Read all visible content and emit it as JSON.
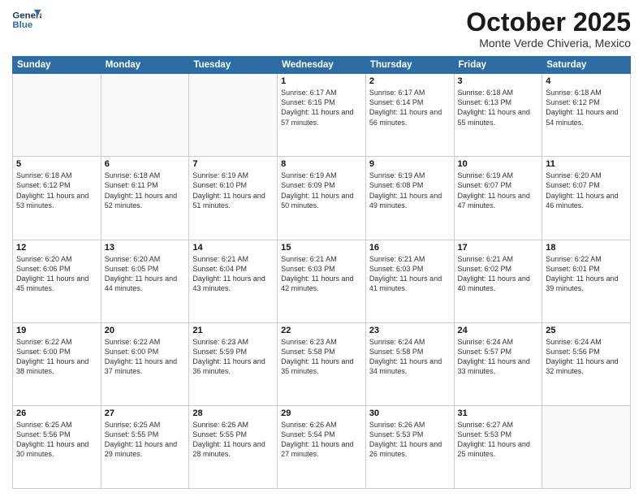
{
  "logo": {
    "line1": "General",
    "line2": "Blue"
  },
  "title": "October 2025",
  "location": "Monte Verde Chiveria, Mexico",
  "days_header": [
    "Sunday",
    "Monday",
    "Tuesday",
    "Wednesday",
    "Thursday",
    "Friday",
    "Saturday"
  ],
  "weeks": [
    [
      {
        "day": "",
        "info": ""
      },
      {
        "day": "",
        "info": ""
      },
      {
        "day": "",
        "info": ""
      },
      {
        "day": "1",
        "info": "Sunrise: 6:17 AM\nSunset: 6:15 PM\nDaylight: 11 hours and 57 minutes."
      },
      {
        "day": "2",
        "info": "Sunrise: 6:17 AM\nSunset: 6:14 PM\nDaylight: 11 hours and 56 minutes."
      },
      {
        "day": "3",
        "info": "Sunrise: 6:18 AM\nSunset: 6:13 PM\nDaylight: 11 hours and 55 minutes."
      },
      {
        "day": "4",
        "info": "Sunrise: 6:18 AM\nSunset: 6:12 PM\nDaylight: 11 hours and 54 minutes."
      }
    ],
    [
      {
        "day": "5",
        "info": "Sunrise: 6:18 AM\nSunset: 6:12 PM\nDaylight: 11 hours and 53 minutes."
      },
      {
        "day": "6",
        "info": "Sunrise: 6:18 AM\nSunset: 6:11 PM\nDaylight: 11 hours and 52 minutes."
      },
      {
        "day": "7",
        "info": "Sunrise: 6:19 AM\nSunset: 6:10 PM\nDaylight: 11 hours and 51 minutes."
      },
      {
        "day": "8",
        "info": "Sunrise: 6:19 AM\nSunset: 6:09 PM\nDaylight: 11 hours and 50 minutes."
      },
      {
        "day": "9",
        "info": "Sunrise: 6:19 AM\nSunset: 6:08 PM\nDaylight: 11 hours and 49 minutes."
      },
      {
        "day": "10",
        "info": "Sunrise: 6:19 AM\nSunset: 6:07 PM\nDaylight: 11 hours and 47 minutes."
      },
      {
        "day": "11",
        "info": "Sunrise: 6:20 AM\nSunset: 6:07 PM\nDaylight: 11 hours and 46 minutes."
      }
    ],
    [
      {
        "day": "12",
        "info": "Sunrise: 6:20 AM\nSunset: 6:06 PM\nDaylight: 11 hours and 45 minutes."
      },
      {
        "day": "13",
        "info": "Sunrise: 6:20 AM\nSunset: 6:05 PM\nDaylight: 11 hours and 44 minutes."
      },
      {
        "day": "14",
        "info": "Sunrise: 6:21 AM\nSunset: 6:04 PM\nDaylight: 11 hours and 43 minutes."
      },
      {
        "day": "15",
        "info": "Sunrise: 6:21 AM\nSunset: 6:03 PM\nDaylight: 11 hours and 42 minutes."
      },
      {
        "day": "16",
        "info": "Sunrise: 6:21 AM\nSunset: 6:03 PM\nDaylight: 11 hours and 41 minutes."
      },
      {
        "day": "17",
        "info": "Sunrise: 6:21 AM\nSunset: 6:02 PM\nDaylight: 11 hours and 40 minutes."
      },
      {
        "day": "18",
        "info": "Sunrise: 6:22 AM\nSunset: 6:01 PM\nDaylight: 11 hours and 39 minutes."
      }
    ],
    [
      {
        "day": "19",
        "info": "Sunrise: 6:22 AM\nSunset: 6:00 PM\nDaylight: 11 hours and 38 minutes."
      },
      {
        "day": "20",
        "info": "Sunrise: 6:22 AM\nSunset: 6:00 PM\nDaylight: 11 hours and 37 minutes."
      },
      {
        "day": "21",
        "info": "Sunrise: 6:23 AM\nSunset: 5:59 PM\nDaylight: 11 hours and 36 minutes."
      },
      {
        "day": "22",
        "info": "Sunrise: 6:23 AM\nSunset: 5:58 PM\nDaylight: 11 hours and 35 minutes."
      },
      {
        "day": "23",
        "info": "Sunrise: 6:24 AM\nSunset: 5:58 PM\nDaylight: 11 hours and 34 minutes."
      },
      {
        "day": "24",
        "info": "Sunrise: 6:24 AM\nSunset: 5:57 PM\nDaylight: 11 hours and 33 minutes."
      },
      {
        "day": "25",
        "info": "Sunrise: 6:24 AM\nSunset: 5:56 PM\nDaylight: 11 hours and 32 minutes."
      }
    ],
    [
      {
        "day": "26",
        "info": "Sunrise: 6:25 AM\nSunset: 5:56 PM\nDaylight: 11 hours and 30 minutes."
      },
      {
        "day": "27",
        "info": "Sunrise: 6:25 AM\nSunset: 5:55 PM\nDaylight: 11 hours and 29 minutes."
      },
      {
        "day": "28",
        "info": "Sunrise: 6:26 AM\nSunset: 5:55 PM\nDaylight: 11 hours and 28 minutes."
      },
      {
        "day": "29",
        "info": "Sunrise: 6:26 AM\nSunset: 5:54 PM\nDaylight: 11 hours and 27 minutes."
      },
      {
        "day": "30",
        "info": "Sunrise: 6:26 AM\nSunset: 5:53 PM\nDaylight: 11 hours and 26 minutes."
      },
      {
        "day": "31",
        "info": "Sunrise: 6:27 AM\nSunset: 5:53 PM\nDaylight: 11 hours and 25 minutes."
      },
      {
        "day": "",
        "info": ""
      }
    ]
  ]
}
